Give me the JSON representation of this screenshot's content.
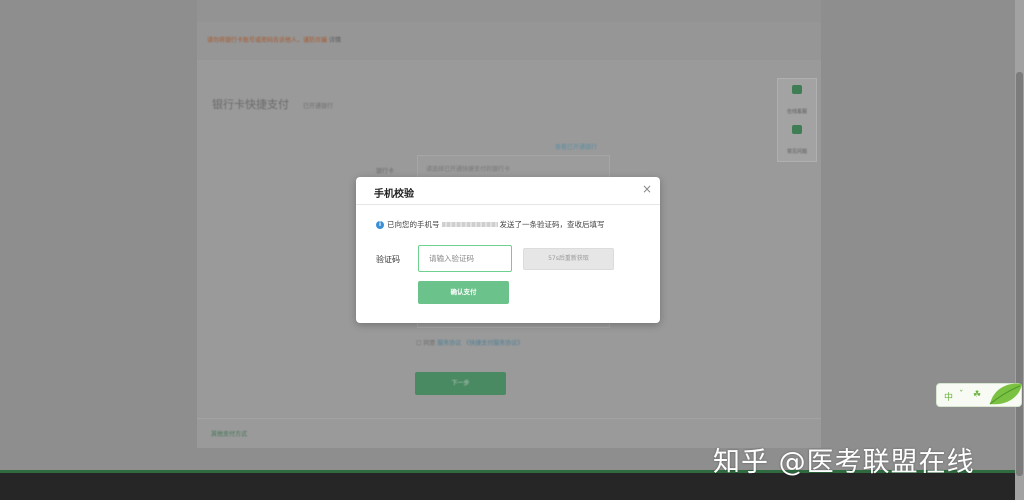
{
  "background": {
    "notice_text": "请勿将银行卡账号或密码告诉他人，谨防诈骗",
    "notice_link": "详情",
    "page_title": "银行卡快捷支付",
    "page_subtitle": "已开通银行",
    "right_link": "查看已开通银行",
    "row_label": "银行卡",
    "row_value": "请选择已开通快捷支付的银行卡",
    "agree_prefix": "同意",
    "agree_link1": "服务协议",
    "agree_link2": "《快捷支付服务协议》",
    "submit_label": "下一步",
    "bottom_link": "其他支付方式",
    "side_tools": [
      "在线客服",
      "常见问题"
    ]
  },
  "modal": {
    "title": "手机校验",
    "close_glyph": "×",
    "info_prefix": "已向您的手机号",
    "info_suffix": "发送了一条验证码，查收后填写",
    "code_label": "验证码",
    "code_placeholder": "请输入验证码",
    "code_value": "",
    "resend_label": "57s后重新获取",
    "confirm_label": "确认支付"
  },
  "widget": {
    "char1": "中",
    "char2": "ˇ",
    "char3": "☘"
  },
  "watermark": "知乎 @医考联盟在线",
  "colors": {
    "accent": "#6cc28b",
    "input_border": "#6fd08f",
    "info": "#3b8fd6"
  }
}
